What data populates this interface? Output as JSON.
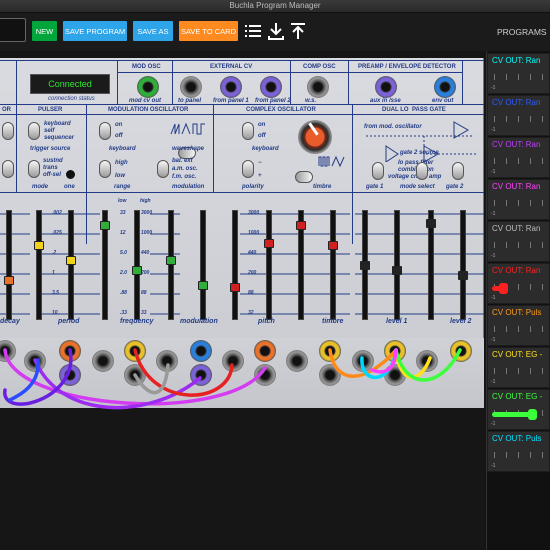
{
  "window": {
    "title": "Buchla Program Manager"
  },
  "toolbar": {
    "new": "NEW",
    "save_program": "SAVE PROGRAM",
    "save_as": "SAVE AS",
    "save_to_card": "SAVE TO CARD",
    "programs": "PROGRAMS",
    "menu_icon": "list-icon",
    "download_icon": "download-icon",
    "upload_icon": "upload-icon"
  },
  "status": {
    "connected": "Connected",
    "label": "connection status"
  },
  "sections": {
    "mod_osc": "MOD OSC",
    "external_cv": "EXTERNAL CV",
    "comp_osc": "COMP OSC",
    "preamp": "PREAMP / ENVELOPE DETECTOR",
    "pulser": "PULSER",
    "modulation_oscillator": "MODULATION OSCILLATOR",
    "complex_oscillator": "COMPLEX OSCILLATOR",
    "dual_lo": "DUAL LO",
    "pass_gate": "PASS GATE",
    "or": "OR"
  },
  "labels": {
    "mod_cv_out": "mod cv out",
    "to_panel": "to panel",
    "from_panel1": "from panel 1",
    "from_panel2": "from panel 2",
    "ws": "w.s.",
    "aux_in": "aux in /sse",
    "env_out": "env out",
    "keyboard_self_seq": "keyboard\nself\nsequencer",
    "trigger_source": "trigger source",
    "sustnd": "sustnd",
    "trans": "trans",
    "off_sel": "off-sel",
    "mode": "mode",
    "one": "one",
    "on": "on",
    "off": "off",
    "keyboard": "keyboard",
    "waveshape": "waveshape",
    "high": "high",
    "low": "low",
    "range": "range",
    "bal_ext": "bal. ext",
    "am_osc": "a.m. osc.",
    "fm_osc": "f.m. osc.",
    "modulation": "modulation",
    "plus": "+",
    "minus": "−",
    "polarity": "polarity",
    "timbre": "timbre",
    "from_mod_osc": "from mod. oscillator",
    "gate2_source": "gate 2 source",
    "lo_pass": "lo pass filter",
    "combination": "combination",
    "voltage": "voltage cntrld amp",
    "gate1": "gate 1",
    "mode_select": "mode select",
    "gate2": "gate 2"
  },
  "slider_labels": [
    "decay",
    "period",
    "frequency",
    "modulation",
    "pitch",
    "timbre",
    "level 1",
    "level 2"
  ],
  "scales": {
    "period": [
      ".002",
      ".025",
      ".2",
      "1",
      "3.5",
      "10"
    ],
    "frequency_low": [
      "33",
      "12",
      "5.0",
      "2.0",
      ".88",
      ".33"
    ],
    "frequency_high": [
      "3000",
      "1000",
      "440",
      "200",
      "88",
      "33"
    ],
    "pitch": [
      "3000",
      "1000",
      "440",
      "200",
      "88",
      "32"
    ],
    "freq_low_hdr": "low",
    "freq_high_hdr": "high"
  },
  "slider_values": [
    0.35,
    0.7,
    0.55,
    0.9,
    0.45,
    0.55,
    0.3,
    0.28,
    0.72,
    0.9
  ],
  "cv_slots": [
    {
      "label": "CV OUT: Ran",
      "color": "#00ffff",
      "value": "-1"
    },
    {
      "label": "CV OUT: Ran",
      "color": "#2d5bff",
      "value": "-1"
    },
    {
      "label": "CV OUT: Ran",
      "color": "#c03cff",
      "value": "-1"
    },
    {
      "label": "CV OUT: Ran",
      "color": "#ff40ff",
      "value": "-1"
    },
    {
      "label": "CV OUT: Ran",
      "color": "#bbbbbb",
      "value": "-1"
    },
    {
      "label": "CV OUT: Ran",
      "color": "#ff2020",
      "value": "-1"
    },
    {
      "label": "CV OUT: Puls",
      "color": "#ff9a1a",
      "value": "-1"
    },
    {
      "label": "CV OUT: EG -",
      "color": "#ffe21a",
      "value": "-1"
    },
    {
      "label": "CV OUT: EG -",
      "color": "#3cff3c",
      "value": "-1"
    },
    {
      "label": "CV OUT: Puls",
      "color": "#00e5ff",
      "value": "-1"
    }
  ],
  "cv_levels": [
    0,
    0,
    0,
    0,
    0,
    0.05,
    0,
    0,
    0.55,
    0
  ],
  "colors": {
    "new": "#00a53c",
    "save_program": "#2ea4e9",
    "save_as": "#2ea4e9",
    "save_to_card": "#ff8a1f",
    "panel_text": "#233b86"
  }
}
